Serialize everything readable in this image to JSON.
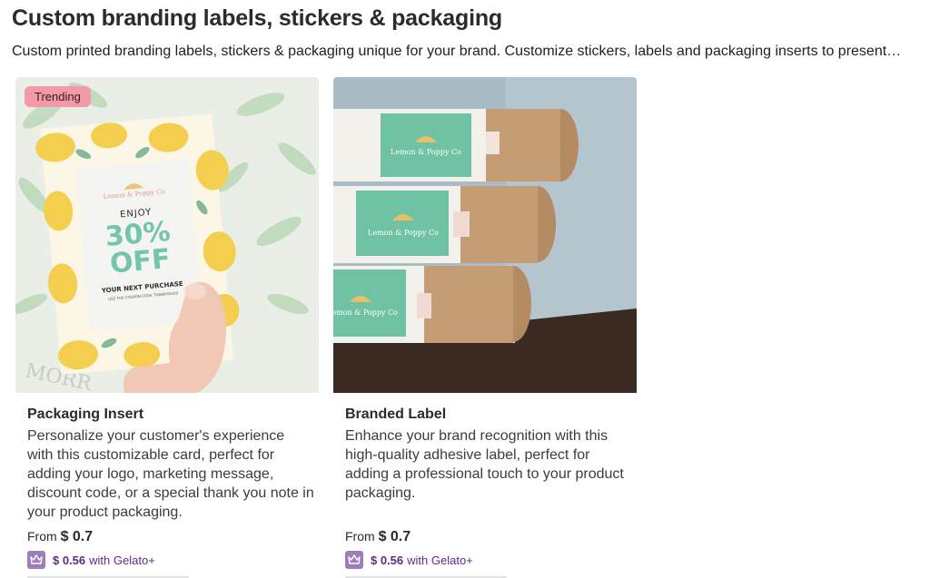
{
  "header": {
    "title": "Custom branding labels, stickers & packaging",
    "description": "Custom printed branding labels, stickers & packaging unique for your brand. Customize stickers, labels and packaging inserts to present…"
  },
  "products": [
    {
      "badge": "Trending",
      "image_text": {
        "brand": "Lemon & Poppy Co",
        "enjoy": "ENJOY",
        "percent": "30%",
        "off": "OFF",
        "next": "YOUR NEXT PURCHASE",
        "small": "USE THE COUPON CODE THANKYOU20"
      },
      "title": "Packaging Insert",
      "description": "Personalize your customer's experience with this customizable card, perfect for adding your logo, marketing message, discount code, or a special thank you note in your product packaging.",
      "price_prefix": "From",
      "price": "$ 0.7",
      "plus_price": "$ 0.56",
      "plus_suffix": "with Gelato+"
    },
    {
      "image_text": {
        "brand": "Lemon & Poppy Co"
      },
      "title": "Branded Label",
      "description": "Enhance your brand recognition with this high-quality adhesive label, perfect for adding a professional touch to your product packaging.",
      "price_prefix": "From",
      "price": "$ 0.7",
      "plus_price": "$ 0.56",
      "plus_suffix": "with Gelato+"
    }
  ],
  "colors": {
    "badge": "#f39aa8",
    "gelato_plus": "#9e7dbb",
    "label_green": "#6fc2a3"
  },
  "icons": {
    "plus_icon": "crown-icon"
  }
}
